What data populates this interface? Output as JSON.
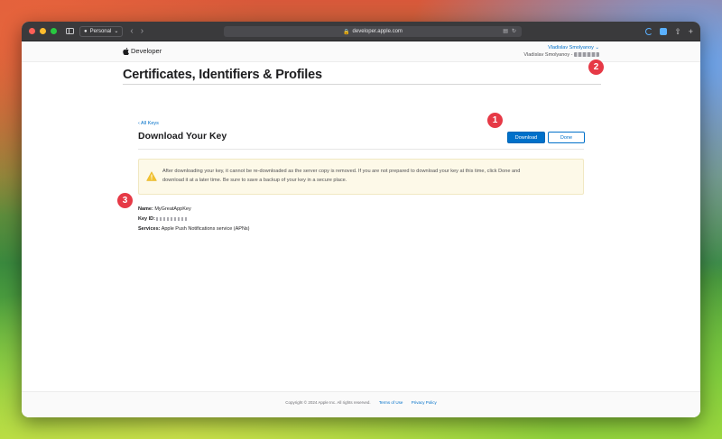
{
  "browser": {
    "profile_label": "Personal",
    "address_text": "developer.apple.com"
  },
  "global_nav": {
    "brand": "Developer",
    "user_name": "Vladislav Smolyanoy ⌄",
    "team_label": "Vladislav Smolyanoy -"
  },
  "page": {
    "title": "Certificates, Identifiers & Profiles",
    "breadcrumb": "‹ All Keys",
    "heading": "Download Your Key",
    "download_button": "Download",
    "done_button": "Done"
  },
  "warning": {
    "text": "After downloading your key, it cannot be re-downloaded as the server copy is removed. If you are not prepared to download your key at this time, click Done and download it at a later time. Be sure to save a backup of your key in a secure place."
  },
  "details": {
    "name_label": "Name:",
    "name_value": "MyGreatAppKey",
    "keyid_label": "Key ID:",
    "services_label": "Services:",
    "services_value": "Apple Push Notifications service (APNs)"
  },
  "footer": {
    "copyright": "Copyright © 2024 Apple Inc. All rights reserved.",
    "terms": "Terms of Use",
    "privacy": "Privacy Policy"
  },
  "callouts": [
    "1",
    "2",
    "3"
  ],
  "colors": {
    "accent": "#0070c9",
    "callout": "#e63946",
    "warning_bg": "#fdf9e8"
  }
}
